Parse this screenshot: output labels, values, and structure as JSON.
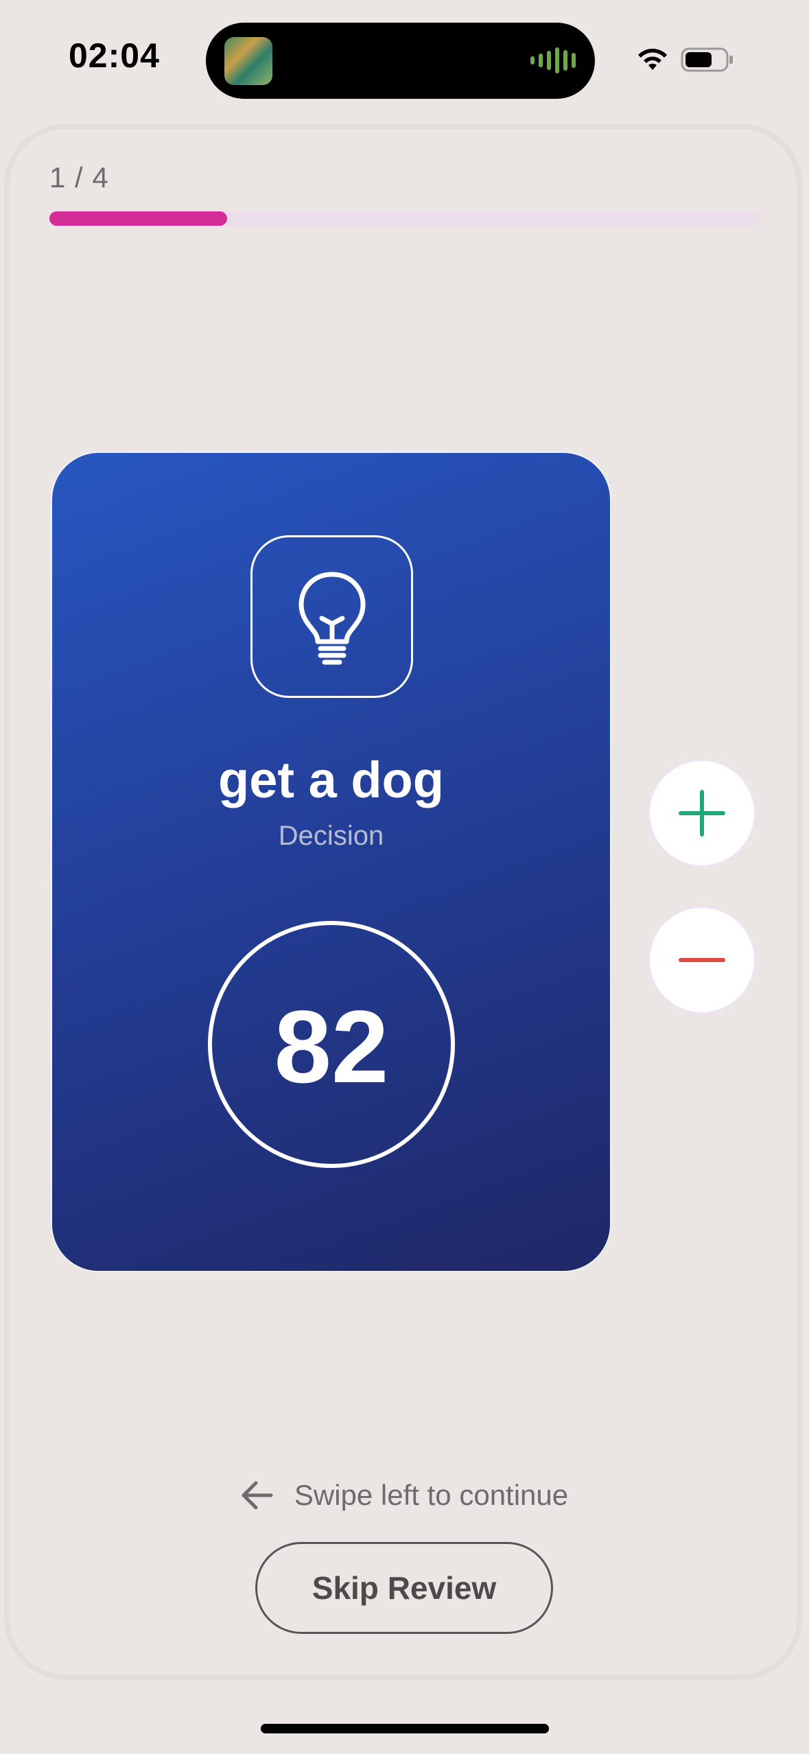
{
  "status_bar": {
    "time": "02:04",
    "icons": [
      "album-art",
      "waveform-icon",
      "wifi-icon",
      "battery-icon"
    ]
  },
  "progress": {
    "label": "1 / 4",
    "current": 1,
    "total": 4,
    "fraction": 0.25,
    "color": "#d42d9a",
    "track_color": "#ebdde9"
  },
  "card": {
    "icon": "lightbulb-icon",
    "title": "get a dog",
    "subtitle": "Decision",
    "score": "82",
    "gradient": [
      "#2757c1",
      "#1f2766"
    ]
  },
  "actions": {
    "plus_icon": "plus-icon",
    "plus_color": "#1fa876",
    "minus_icon": "minus-icon",
    "minus_color": "#e04a45"
  },
  "footer": {
    "swipe_hint": "Swipe left to continue",
    "skip_label": "Skip Review"
  }
}
